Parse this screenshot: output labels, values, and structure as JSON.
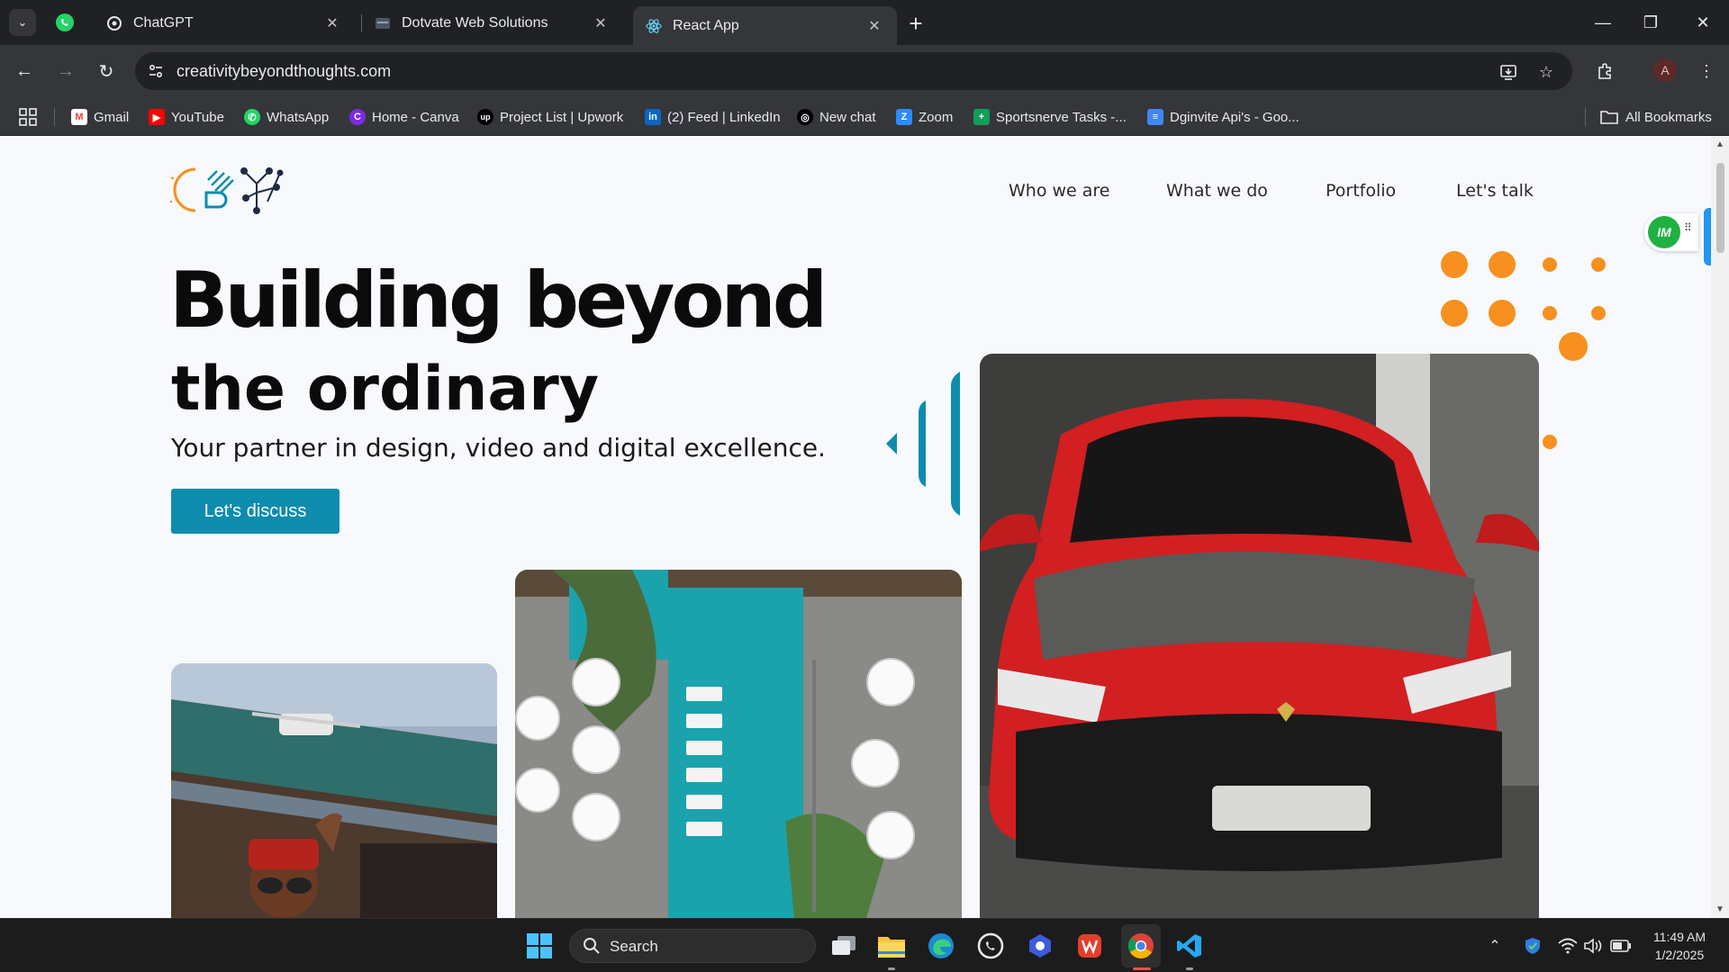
{
  "browser": {
    "tabs": [
      {
        "title": "ChatGPT",
        "active": false
      },
      {
        "title": "Dotvate Web Solutions",
        "active": false
      },
      {
        "title": "React App",
        "active": true
      }
    ],
    "url": "creativitybeyondthoughts.com",
    "profile_initial": "A",
    "bookmarks": [
      {
        "label": "Gmail",
        "icon": "gmail-icon",
        "color": "#ea4335"
      },
      {
        "label": "YouTube",
        "icon": "youtube-icon",
        "color": "#ff0000"
      },
      {
        "label": "WhatsApp",
        "icon": "whatsapp-icon",
        "color": "#25d366"
      },
      {
        "label": "Home - Canva",
        "icon": "canva-icon",
        "color": "#7d2ae8"
      },
      {
        "label": "Project List | Upwork",
        "icon": "upwork-icon",
        "color": "#000000"
      },
      {
        "label": "(2) Feed | LinkedIn",
        "icon": "linkedin-icon",
        "color": "#0a66c2"
      },
      {
        "label": "New chat",
        "icon": "openai-icon",
        "color": "#000000"
      },
      {
        "label": "Zoom",
        "icon": "zoom-icon",
        "color": "#2d8cff"
      },
      {
        "label": "Sportsnerve Tasks -...",
        "icon": "sheets-icon",
        "color": "#0f9d58"
      },
      {
        "label": "Dginvite Api's - Goo...",
        "icon": "docs-icon",
        "color": "#4285f4"
      }
    ],
    "all_bookmarks": "All Bookmarks"
  },
  "site": {
    "nav": [
      "Who we are",
      "What we do",
      "Portfolio",
      "Let's talk"
    ],
    "hero": {
      "line1": "Building beyond",
      "line2": "the ordinary",
      "subtitle": "Your partner in design, video and digital excellence.",
      "cta": "Let's discuss"
    },
    "widget_badge": "IM",
    "accent_color": "#0e8cad",
    "dot_color": "#f7901e"
  },
  "taskbar": {
    "search_placeholder": "Search",
    "time": "11:49 AM",
    "date": "1/2/2025"
  }
}
